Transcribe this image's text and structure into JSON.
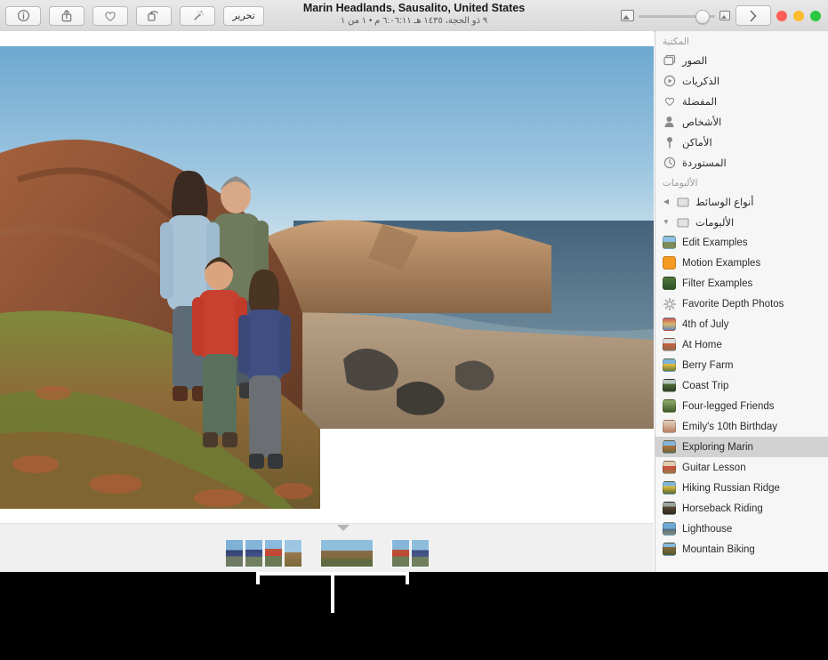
{
  "window": {
    "title": "Marin Headlands, Sausalito, United States",
    "subtitle": "٩ ذو الحجة، ١٤٣٥ هـ ٦:٠٦:١١ م • ١ من ١"
  },
  "toolbar": {
    "edit_label": "تحرير",
    "enhance_label": "enhance-wand-icon",
    "rotate_label": "rotate-icon",
    "favorite_label": "heart-icon",
    "share_label": "share-icon",
    "info_label": "info-icon",
    "zoom_small_label": "small-photo-icon",
    "zoom_large_label": "large-photo-icon",
    "sidebar_toggle_label": "›",
    "traffic": {
      "close": "#ff5f57",
      "minimize": "#febc2e",
      "zoom": "#28c840"
    }
  },
  "sidebar": {
    "library_header": "المكتبة",
    "library_items": [
      {
        "label": "الصور",
        "icon": "photos-icon"
      },
      {
        "label": "الذكريات",
        "icon": "memories-icon"
      },
      {
        "label": "المفضلة",
        "icon": "heart-icon"
      },
      {
        "label": "الأشخاص",
        "icon": "people-icon"
      },
      {
        "label": "الأماكن",
        "icon": "places-pin-icon"
      },
      {
        "label": "المستوردة",
        "icon": "imported-clock-icon"
      }
    ],
    "albums_header": "الألبومات",
    "folder_items": [
      {
        "label": "أنواع الوسائط",
        "icon": "folder-icon",
        "disclosure": "◀"
      },
      {
        "label": "الألبومات",
        "icon": "folder-icon",
        "disclosure": "▼"
      }
    ],
    "albums": [
      {
        "label": "Edit Examples",
        "selected": false
      },
      {
        "label": "Motion Examples",
        "selected": false
      },
      {
        "label": "Filter Examples",
        "selected": false
      },
      {
        "label": "Favorite Depth Photos",
        "selected": false,
        "icon": "gear-icon"
      },
      {
        "label": "4th of July",
        "selected": false
      },
      {
        "label": "At Home",
        "selected": false
      },
      {
        "label": "Berry Farm",
        "selected": false
      },
      {
        "label": "Coast Trip",
        "selected": false
      },
      {
        "label": "Four-legged Friends",
        "selected": false
      },
      {
        "label": "Emily's 10th Birthday",
        "selected": false
      },
      {
        "label": "Exploring Marin",
        "selected": true
      },
      {
        "label": "Guitar Lesson",
        "selected": false
      },
      {
        "label": "Hiking Russian Ridge",
        "selected": false
      },
      {
        "label": "Horseback Riding",
        "selected": false
      },
      {
        "label": "Lighthouse",
        "selected": false
      },
      {
        "label": "Mountain Biking",
        "selected": false
      }
    ]
  },
  "viewer": {
    "photo_alt": "family-portrait-on-coastal-bluff",
    "filmstrip_arrow": "selection-marker"
  }
}
